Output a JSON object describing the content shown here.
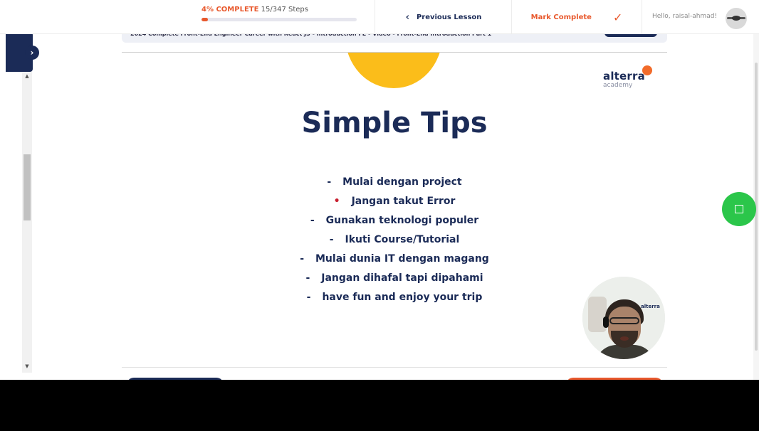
{
  "progress": {
    "percent_label": "4% COMPLETE",
    "steps_label": "15/347 Steps",
    "fraction": 0.04
  },
  "header": {
    "prev_lesson_label": "Previous Lesson",
    "prev_icon": "chevron-left-icon",
    "mark_complete_label": "Mark Complete",
    "check_icon": "check-icon",
    "greeting": "Hello, raisal-ahmad!",
    "accent_color": "#e8582c",
    "brand_color": "#1b2b57"
  },
  "breadcrumb": {
    "text": "2024 Complete Front-End Engineer Career with React JS - Introduction FE - Video - Front-End Introduction Part 1"
  },
  "slide": {
    "brand_name": "alterra",
    "brand_sub": "academy",
    "title": "Simple Tips",
    "tips": [
      {
        "text": "Mulai dengan project"
      },
      {
        "text": "Jangan takut Error"
      },
      {
        "text": "Gunakan teknologi populer"
      },
      {
        "text": "Ikuti Course/Tutorial"
      },
      {
        "text": "Mulai dunia IT dengan magang"
      },
      {
        "text": "Jangan dihafal tapi dipahami"
      },
      {
        "text": "have fun and enjoy your trip"
      }
    ]
  },
  "webcam": {
    "logo_text": "alterra"
  },
  "icons": {
    "sidebar_toggle": "chevron-right-icon",
    "chat": "chat-icon"
  }
}
